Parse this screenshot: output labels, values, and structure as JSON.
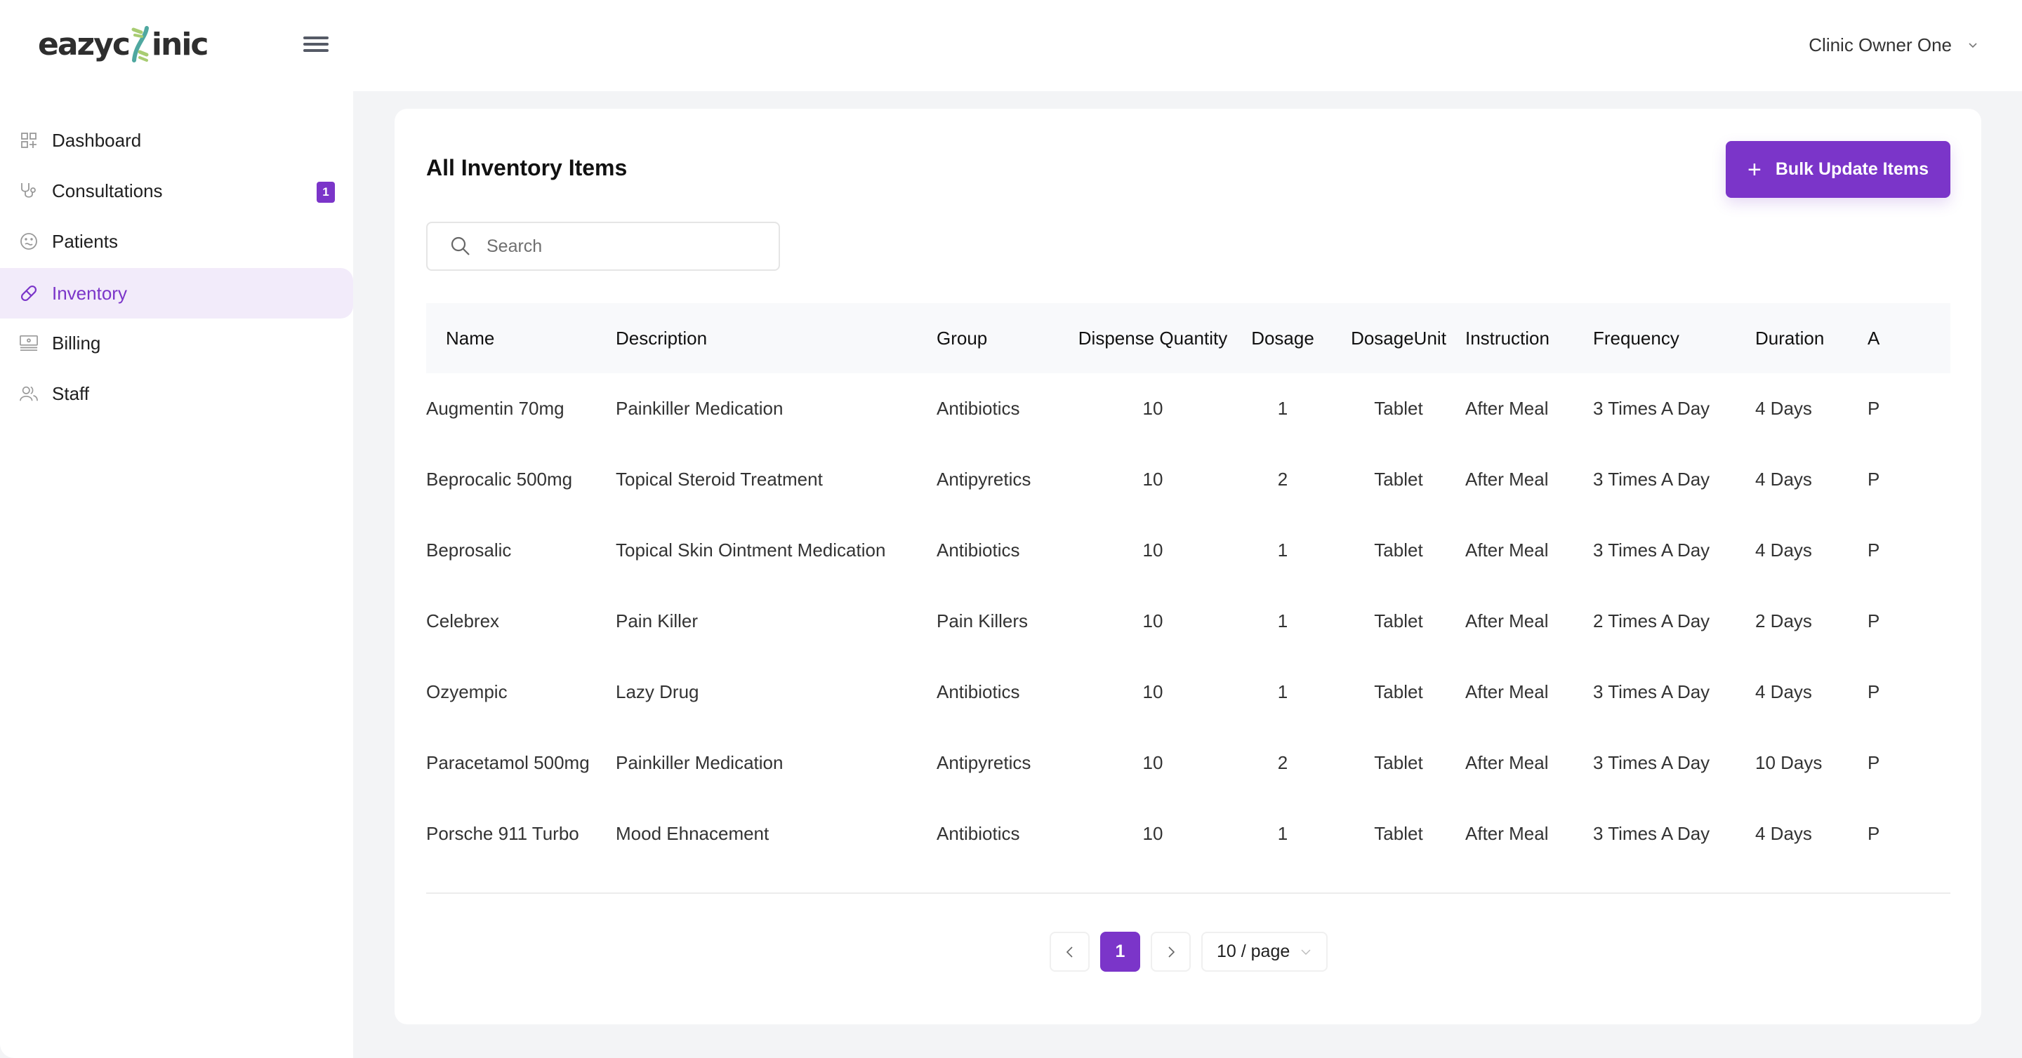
{
  "header": {
    "logo_left": "eazyc",
    "logo_right": "inic",
    "user_name": "Clinic Owner One"
  },
  "colors": {
    "accent": "#7b35c9",
    "active_bg": "#f2ebfa",
    "page_bg": "#f3f4f6",
    "table_header_bg": "#f8f9fb"
  },
  "sidebar": {
    "items": [
      {
        "label": "Dashboard",
        "icon": "dashboard-icon"
      },
      {
        "label": "Consultations",
        "icon": "stethoscope-icon",
        "badge": "1"
      },
      {
        "label": "Patients",
        "icon": "face-icon"
      },
      {
        "label": "Inventory",
        "icon": "pill-icon",
        "active": true
      },
      {
        "label": "Billing",
        "icon": "billing-icon"
      },
      {
        "label": "Staff",
        "icon": "staff-icon"
      }
    ]
  },
  "main": {
    "title": "All Inventory Items",
    "bulk_button_label": "Bulk Update Items",
    "search": {
      "placeholder": "Search",
      "value": ""
    },
    "table": {
      "columns": [
        "Name",
        "Description",
        "Group",
        "Dispense Quantity",
        "Dosage",
        "DosageUnit",
        "Instruction",
        "Frequency",
        "Duration",
        "A"
      ],
      "rows": [
        [
          "Augmentin 70mg",
          "Painkiller Medication",
          "Antibiotics",
          "10",
          "1",
          "Tablet",
          "After Meal",
          "3 Times A Day",
          "4 Days",
          "P"
        ],
        [
          "Beprocalic 500mg",
          "Topical Steroid Treatment",
          "Antipyretics",
          "10",
          "2",
          "Tablet",
          "After Meal",
          "3 Times A Day",
          "4 Days",
          "P"
        ],
        [
          "Beprosalic",
          "Topical Skin Ointment Medication",
          "Antibiotics",
          "10",
          "1",
          "Tablet",
          "After Meal",
          "3 Times A Day",
          "4 Days",
          "P"
        ],
        [
          "Celebrex",
          "Pain Killer",
          "Pain Killers",
          "10",
          "1",
          "Tablet",
          "After Meal",
          "2 Times A Day",
          "2 Days",
          "P"
        ],
        [
          "Ozyempic",
          "Lazy Drug",
          "Antibiotics",
          "10",
          "1",
          "Tablet",
          "After Meal",
          "3 Times A Day",
          "4 Days",
          "P"
        ],
        [
          "Paracetamol 500mg",
          "Painkiller Medication",
          "Antipyretics",
          "10",
          "2",
          "Tablet",
          "After Meal",
          "3 Times A Day",
          "10 Days",
          "P"
        ],
        [
          "Porsche 911 Turbo",
          "Mood Ehnacement",
          "Antibiotics",
          "10",
          "1",
          "Tablet",
          "After Meal",
          "3 Times A Day",
          "4 Days",
          "P"
        ]
      ]
    },
    "pagination": {
      "current_page": "1",
      "page_size_label": "10 / page"
    }
  }
}
